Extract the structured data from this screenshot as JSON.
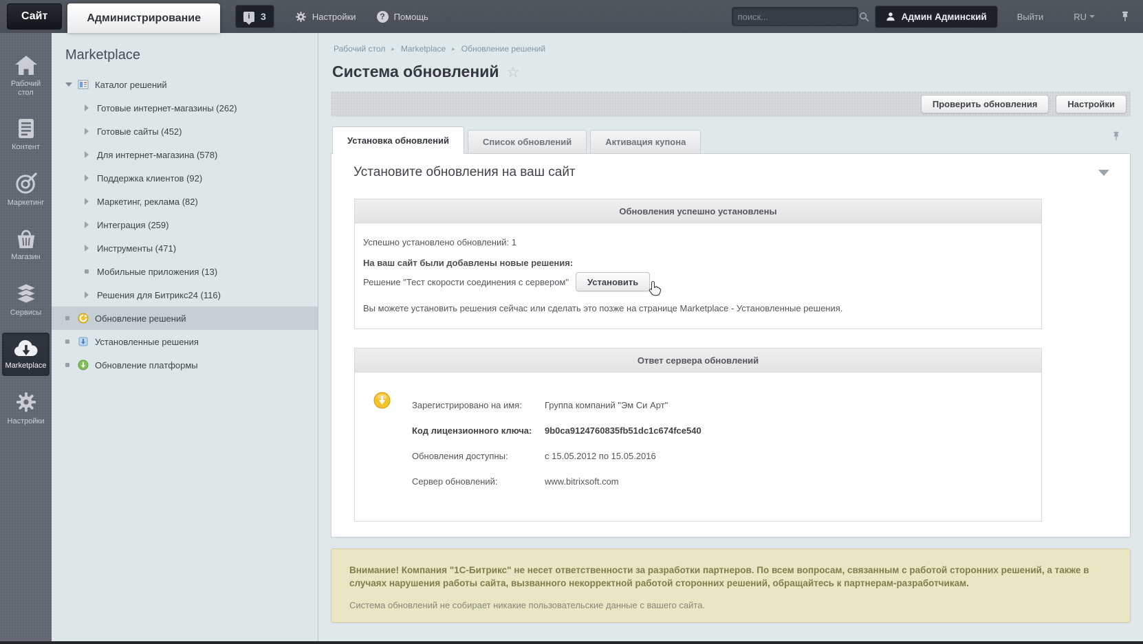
{
  "topbar": {
    "site_tab": "Сайт",
    "admin_tab": "Администрирование",
    "notifications_count": "3",
    "settings_label": "Настройки",
    "help_label": "Помощь",
    "search_placeholder": "поиск...",
    "user_name": "Админ Админский",
    "logout_label": "Выйти",
    "lang_label": "RU"
  },
  "rail": {
    "items": [
      {
        "label": "Рабочий стол",
        "icon": "home-icon"
      },
      {
        "label": "Контент",
        "icon": "document-icon"
      },
      {
        "label": "Маркетинг",
        "icon": "target-icon"
      },
      {
        "label": "Магазин",
        "icon": "basket-icon"
      },
      {
        "label": "Сервисы",
        "icon": "layers-icon"
      },
      {
        "label": "Marketplace",
        "icon": "cloud-download-icon",
        "active": true
      },
      {
        "label": "Настройки",
        "icon": "gear-icon"
      }
    ]
  },
  "sidebar": {
    "title": "Marketplace",
    "items": [
      {
        "label": "Каталог решений",
        "state": "expanded",
        "icon": "catalog-icon"
      },
      {
        "label": "Готовые интернет-магазины (262)",
        "state": "collapsed"
      },
      {
        "label": "Готовые сайты (452)",
        "state": "collapsed"
      },
      {
        "label": "Для интернет-магазина (578)",
        "state": "collapsed"
      },
      {
        "label": "Поддержка клиентов (92)",
        "state": "collapsed"
      },
      {
        "label": "Маркетинг, реклама (82)",
        "state": "collapsed"
      },
      {
        "label": "Интеграция (259)",
        "state": "collapsed"
      },
      {
        "label": "Инструменты (471)",
        "state": "collapsed"
      },
      {
        "label": "Мобильные приложения (13)",
        "state": "leaf"
      },
      {
        "label": "Решения для Битрикс24 (116)",
        "state": "collapsed"
      },
      {
        "label": "Обновление решений",
        "state": "leaf",
        "icon": "solution-update-icon",
        "active": true
      },
      {
        "label": "Установленные решения",
        "state": "leaf",
        "icon": "installed-solutions-icon"
      },
      {
        "label": "Обновление платформы",
        "state": "leaf",
        "icon": "platform-update-icon"
      }
    ]
  },
  "breadcrumb": {
    "items": [
      "Рабочий стол",
      "Marketplace",
      "Обновление решений"
    ]
  },
  "page": {
    "title": "Система обновлений"
  },
  "toolbar": {
    "check_updates_label": "Проверить обновления",
    "settings_label": "Настройки"
  },
  "tabs": [
    {
      "label": "Установка обновлений",
      "active": true
    },
    {
      "label": "Список обновлений",
      "active": false
    },
    {
      "label": "Активация купона",
      "active": false
    }
  ],
  "content": {
    "heading": "Установите обновления на ваш сайт",
    "success_box": {
      "title": "Обновления успешно установлены",
      "installed_line": "Успешно установлено обновлений: 1",
      "added_line": "На ваш сайт были добавлены новые решения:",
      "solution_line": "Решение \"Тест скорости соединения с сервером\"",
      "install_button": "Установить",
      "note": "Вы можете установить решения сейчас или сделать это позже на странице Marketplace - Установленные решения."
    },
    "server_box": {
      "title": "Ответ сервера обновлений",
      "rows": [
        {
          "label": "Зарегистрировано на имя:",
          "value": "Группа компаний \"Эм Си Арт\""
        },
        {
          "label": "Код лицензионного ключа:",
          "value": "9b0ca9124760835fb51dc1c674fce540"
        },
        {
          "label": "Обновления доступны:",
          "value": "с 15.05.2012 по 15.05.2016"
        },
        {
          "label": "Сервер обновлений:",
          "value": "www.bitrixsoft.com"
        }
      ]
    }
  },
  "warning": {
    "bold_text": "Внимание! Компания \"1С-Битрикс\" не несет ответственности за разработки партнеров. По всем вопросам, связанным с работой сторонних решений, а также в случаях нарушения работы сайта, вызванного некорректной работой сторонних решений, обращайтесь к партнерам-разработчикам.",
    "normal_text": "Система обновлений не собирает никакие пользовательские данные с вашего сайта."
  },
  "colors": {
    "topbar_bg": "#4c525b",
    "rail_bg": "#656c78",
    "sidebar_bg": "#dde7ea",
    "main_bg": "#dfe9ec",
    "active_row_bg": "#c6cfd4",
    "warning_bg": "#eae6c3",
    "warning_border": "#d5cfa0",
    "warning_text": "#7e7e4d",
    "gold_icon": "#f2c428",
    "green_icon": "#83bd57",
    "blue_icon": "#bcd6ef"
  }
}
